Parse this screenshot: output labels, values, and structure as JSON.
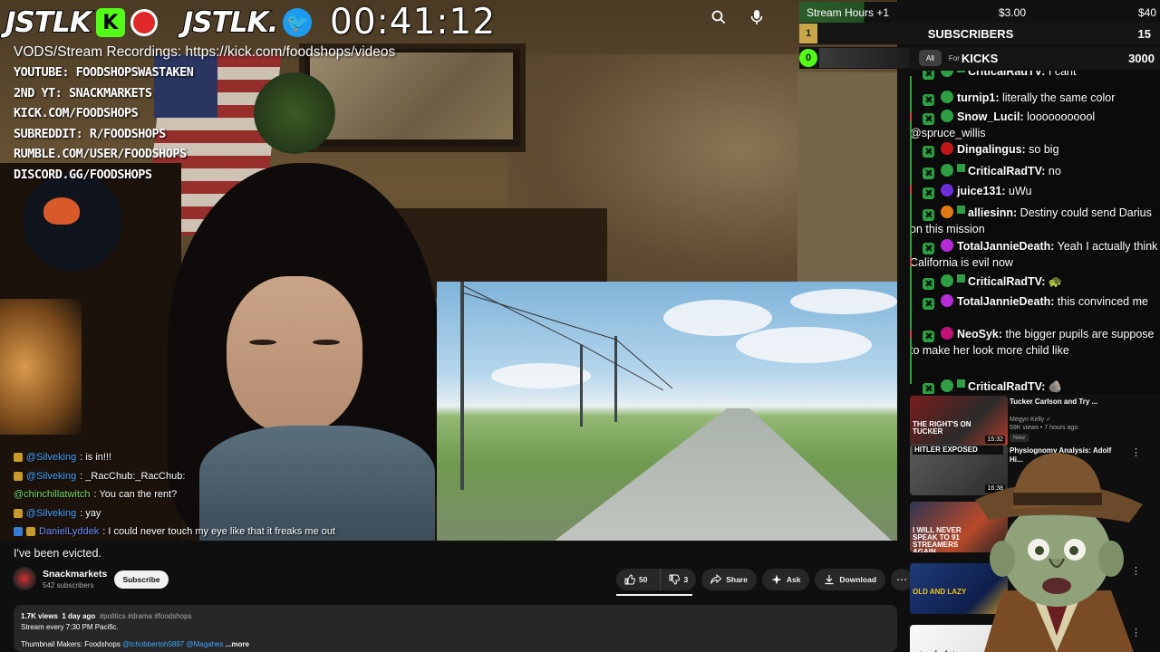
{
  "overlay": {
    "logo_main": "JSTLK",
    "kick_letter": "K",
    "logo_secondary": "JSTLK.",
    "twitter_glyph": "🐦",
    "timer": "00:41:12",
    "vods": "VODS/Stream Recordings: https://kick.com/foodshops/videos",
    "socials": [
      "YOUTUBE: FOODSHOPSWASTAKEN",
      "2ND YT: SNACKMARKETS",
      "KICK.COM/FOODSHOPS",
      "SUBREDDIT: R/FOODSHOPS",
      "RUMBLE.COM/USER/FOODSHOPS",
      "DISCORD.GG/FOODSHOPS"
    ],
    "chat": [
      {
        "name": "@Silveking",
        "text": " : is in!!!"
      },
      {
        "name": "@Silveking",
        "text": " : _RacChub:_RacChub:"
      },
      {
        "name": "@chinchillatwitch",
        "text": " : You can the rent?"
      },
      {
        "name": "@Silveking",
        "text": " : yay"
      },
      {
        "name": "DanielLyddek",
        "text": " : I could never touch my eye like that it freaks me out"
      }
    ]
  },
  "video": {
    "title": "I've been evicted.",
    "channel": "Snackmarkets",
    "subscribers": "542 subscribers",
    "subscribe_label": "Subscribe",
    "likes": "50",
    "dislikes": "3",
    "share": "Share",
    "ask": "Ask",
    "download": "Download",
    "more": "⋯",
    "views": "1.7K views",
    "age": "1 day ago",
    "tags": "#politics #drama #foodshops",
    "schedule": "Stream every 7:30 PM Pacific.",
    "thumbs_label": "Thumbnail Makers: Foodshops",
    "thumbs_links": "@tchobbertoh5897  @Magahes",
    "more_label": "...more"
  },
  "stats": {
    "stream_hours": "Stream Hours +1",
    "stream_amount": "$3.00",
    "stream_right": "$40",
    "sub_rank": "1",
    "subscribers_label": "SUBSCRIBERS",
    "subscribers_count": "15",
    "kicks_rank": "0",
    "chip_all": "All",
    "chip_for": "For",
    "kicks_label": "KICKS",
    "kicks_count": "3000"
  },
  "chat": [
    {
      "name": "CriticalRadTV:",
      "text": " I cant",
      "color": "#2ea043",
      "mod": true
    },
    {
      "name": "turnip1:",
      "text": " literally the same color",
      "color": "#2ea043",
      "mod": false
    },
    {
      "name": "Snow_Lucil:",
      "text": " looooooooool @spruce_willis",
      "color": "#2ea043",
      "mod": false
    },
    {
      "name": "Dingalingus:",
      "text": " so big",
      "color": "#c01818",
      "mod": false
    },
    {
      "name": "CriticalRadTV:",
      "text": " no",
      "color": "#2ea043",
      "mod": true
    },
    {
      "name": "juice131:",
      "text": " uWu",
      "color": "#6a2dd8",
      "mod": false
    },
    {
      "name": "alliesinn:",
      "text": " Destiny could send Darius on this mission",
      "color": "#e07a16",
      "mod": true
    },
    {
      "name": "TotalJannieDeath:",
      "text": " Yeah I actually think California is evil now",
      "color": "#b42bd8",
      "mod": false
    },
    {
      "name": "CriticalRadTV:",
      "text": " 🐢",
      "color": "#2ea043",
      "mod": true
    },
    {
      "name": "TotalJannieDeath:",
      "text": " this convinced me",
      "color": "#b42bd8",
      "mod": false
    },
    {
      "name": "NeoSyk:",
      "text": " the bigger pupils are suppose to make her look more child like",
      "color": "#c0147a",
      "mod": false
    },
    {
      "name": "CriticalRadTV:",
      "text": " 🪨",
      "color": "#2ea043",
      "mod": true
    }
  ],
  "recs": [
    {
      "title": "Tucker Carlson and Try ...",
      "channel": "Megyn Kelly ✓",
      "meta": "59K views • 7 hours ago",
      "badge": "New",
      "duration": "15:32",
      "thumb_text": "THE RIGHT'S ON TUCKER",
      "kebab": "⋮"
    },
    {
      "title": "Physiognomy Analysis: Adolf Hi...",
      "channel": "",
      "meta": "",
      "badge": "",
      "duration": "16:38",
      "thumb_text": "HITLER EXPOSED",
      "kebab": "⋮"
    },
    {
      "title": "",
      "channel": "",
      "meta": "",
      "badge": "",
      "duration": "",
      "thumb_text": "I WILL NEVER SPEAK TO 91 STREAMERS AGAIN",
      "kebab": "⋮"
    },
    {
      "title": "",
      "channel": "",
      "meta": "",
      "badge": "",
      "duration": "",
      "thumb_text": "OLD AND LAZY",
      "kebab": "⋮"
    },
    {
      "title": "",
      "channel": "",
      "meta": "",
      "badge": "",
      "duration": "",
      "thumb_text": "straight",
      "kebab": "⋮"
    }
  ],
  "icons": {
    "search": "search-icon",
    "mic": "mic-icon",
    "like": "thumbs-up-icon",
    "dislike": "thumbs-down-icon",
    "share": "share-icon",
    "ask": "sparkle-icon",
    "download": "download-icon"
  }
}
